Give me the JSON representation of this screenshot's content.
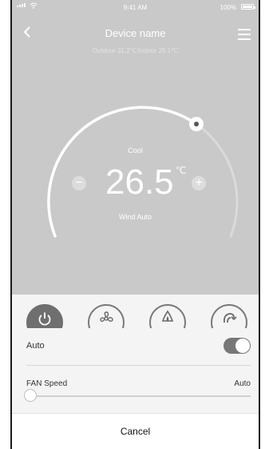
{
  "status_bar": {
    "time": "9:41 AM",
    "battery": "100%"
  },
  "header": {
    "title": "Device name",
    "subtitle": "Outdoor 31.2℃/Indoor 25.1℃"
  },
  "thermostat": {
    "mode": "Cool",
    "temperature": "26.5",
    "unit": "℃",
    "wind": "Wind Auto",
    "minus_symbol": "−",
    "plus_symbol": "+"
  },
  "mode_buttons": [
    "power-icon",
    "fan-icon",
    "heat-icon",
    "dry-icon"
  ],
  "auto": {
    "label": "Auto",
    "enabled": true
  },
  "fan_speed": {
    "label": "FAN Speed",
    "value": "Auto",
    "level": 0
  },
  "cancel_label": "Cancel",
  "colors": {
    "header_bg": "#c9c9c9",
    "accent": "#ffffff",
    "toggle_on": "#777777"
  }
}
